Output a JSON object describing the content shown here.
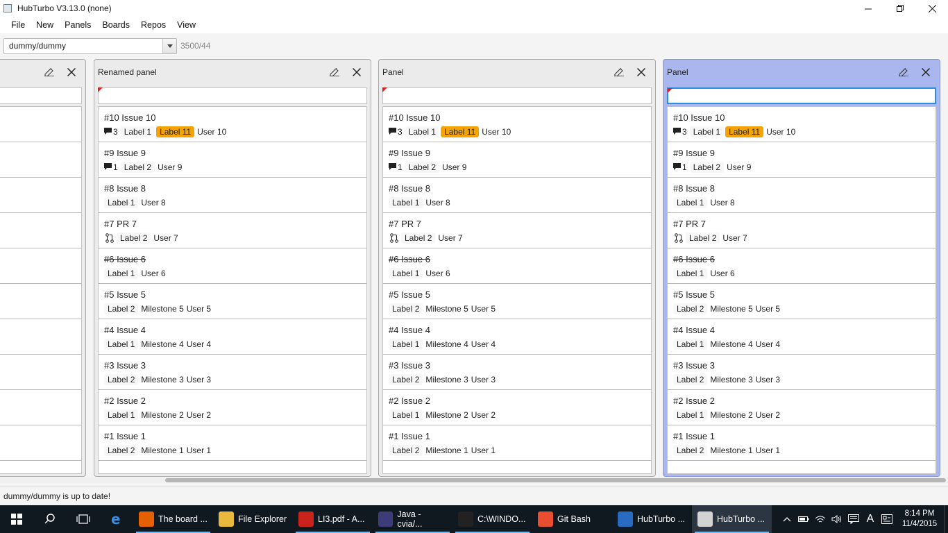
{
  "window": {
    "title": "HubTurbo V3.13.0 (none)",
    "min_icon": "minimize-icon",
    "max_icon": "restore-icon",
    "close_icon": "close-icon"
  },
  "menu": [
    "File",
    "New",
    "Panels",
    "Boards",
    "Repos",
    "View"
  ],
  "repo": {
    "selected": "dummy/dummy",
    "rate_limit": "3500/44"
  },
  "panels": [
    {
      "title": "",
      "partial": true
    },
    {
      "title": "Renamed panel"
    },
    {
      "title": "Panel"
    },
    {
      "title": "Panel",
      "active": true
    }
  ],
  "issues": [
    {
      "title": "#10 Issue 10",
      "comments": "3",
      "labels": [
        "Label 1",
        "Label 11"
      ],
      "highlight": "Label 11",
      "milestone": "",
      "user": "User 10",
      "closed": false,
      "pr": false
    },
    {
      "title": "#9 Issue 9",
      "comments": "1",
      "labels": [
        "Label 2"
      ],
      "milestone": "",
      "user": "User 9",
      "closed": false,
      "pr": false
    },
    {
      "title": "#8 Issue 8",
      "comments": "",
      "labels": [
        "Label 1"
      ],
      "milestone": "",
      "user": "User 8",
      "closed": false,
      "pr": false
    },
    {
      "title": "#7 PR 7",
      "comments": "",
      "labels": [
        "Label 2"
      ],
      "milestone": "",
      "user": "User 7",
      "closed": false,
      "pr": true
    },
    {
      "title": "#6 Issue 6",
      "comments": "",
      "labels": [
        "Label 1"
      ],
      "milestone": "",
      "user": "User 6",
      "closed": true,
      "pr": false
    },
    {
      "title": "#5 Issue 5",
      "comments": "",
      "labels": [
        "Label 2"
      ],
      "milestone": "Milestone 5",
      "user": "User 5",
      "closed": false,
      "pr": false
    },
    {
      "title": "#4 Issue 4",
      "comments": "",
      "labels": [
        "Label 1"
      ],
      "milestone": "Milestone 4",
      "user": "User 4",
      "closed": false,
      "pr": false
    },
    {
      "title": "#3 Issue 3",
      "comments": "",
      "labels": [
        "Label 2"
      ],
      "milestone": "Milestone 3",
      "user": "User 3",
      "closed": false,
      "pr": false
    },
    {
      "title": "#2 Issue 2",
      "comments": "",
      "labels": [
        "Label 1"
      ],
      "milestone": "Milestone 2",
      "user": "User 2",
      "closed": false,
      "pr": false
    },
    {
      "title": "#1 Issue 1",
      "comments": "",
      "labels": [
        "Label 2"
      ],
      "milestone": "Milestone 1",
      "user": "User 1",
      "closed": false,
      "pr": false
    }
  ],
  "status": "dummy/dummy is up to date!",
  "taskbar": {
    "apps": [
      {
        "label": "The board ...",
        "icon": "firefox-icon",
        "color": "#e66000",
        "glyph": "",
        "running": true
      },
      {
        "label": "File Explorer",
        "icon": "folder-icon",
        "color": "#e8b93c",
        "glyph": "",
        "running": false
      },
      {
        "label": "LI3.pdf - A...",
        "icon": "pdf-icon",
        "color": "#c9231c",
        "glyph": "",
        "running": true
      },
      {
        "label": "Java - cvia/...",
        "icon": "eclipse-icon",
        "color": "#3d3b7a",
        "glyph": "",
        "running": true
      },
      {
        "label": "C:\\WINDO...",
        "icon": "cmd-icon",
        "color": "#222222",
        "glyph": "",
        "running": true
      },
      {
        "label": "Git Bash",
        "icon": "git-icon",
        "color": "#e94e31",
        "glyph": "",
        "running": false
      },
      {
        "label": "HubTurbo ...",
        "icon": "intellij-icon",
        "color": "#2a6bc2",
        "glyph": "",
        "running": false
      },
      {
        "label": "HubTurbo ...",
        "icon": "java-icon",
        "color": "#d3d3d3",
        "glyph": "",
        "running": true,
        "focused": true
      }
    ],
    "clock_time": "8:14 PM",
    "clock_date": "11/4/2015",
    "tray_lang": "A"
  },
  "colors": {
    "label_highlight": "#f5a300",
    "active_panel": "#aab7ee",
    "filter_focus": "#2d8ee0"
  }
}
